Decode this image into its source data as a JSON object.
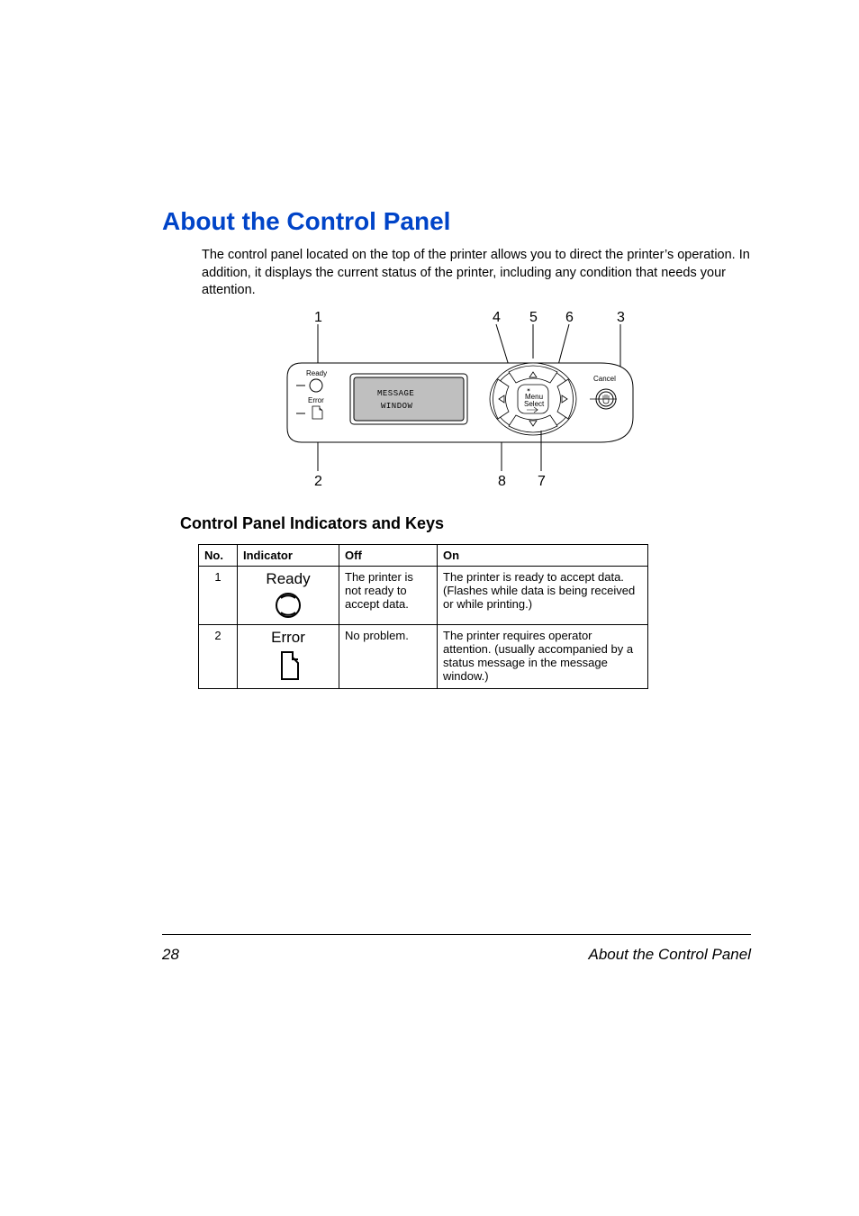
{
  "title": "About the Control Panel",
  "intro": "The control panel located on the top of the printer allows you to direct the printer’s operation. In addition, it displays the current status of the printer, including any condition that needs your attention.",
  "diagram": {
    "callouts_top": [
      "1",
      "4",
      "5",
      "6",
      "3"
    ],
    "callouts_bottom": [
      "2",
      "8",
      "7"
    ],
    "leds": {
      "ready": "Ready",
      "error": "Error"
    },
    "window_line1": "MESSAGE",
    "window_line2": "WINDOW",
    "center_button_l1": "Menu",
    "center_button_l2": "Select",
    "cancel_label": "Cancel"
  },
  "section_title": "Control Panel Indicators and Keys",
  "table": {
    "headers": {
      "no": "No.",
      "indicator": "Indicator",
      "off": "Off",
      "on": "On"
    },
    "rows": [
      {
        "no": "1",
        "indicator_label": "Ready",
        "indicator_icon": "ready",
        "off": "The printer is not ready to accept data.",
        "on": "The printer is ready to accept data.\n(Flashes while data is being received or while printing.)"
      },
      {
        "no": "2",
        "indicator_label": "Error",
        "indicator_icon": "error",
        "off": "No problem.",
        "on": "The printer requires operator attention. (usually accompanied by a status message in the message window.)"
      }
    ]
  },
  "footer": {
    "page_no": "28",
    "title": "About the Control Panel"
  }
}
